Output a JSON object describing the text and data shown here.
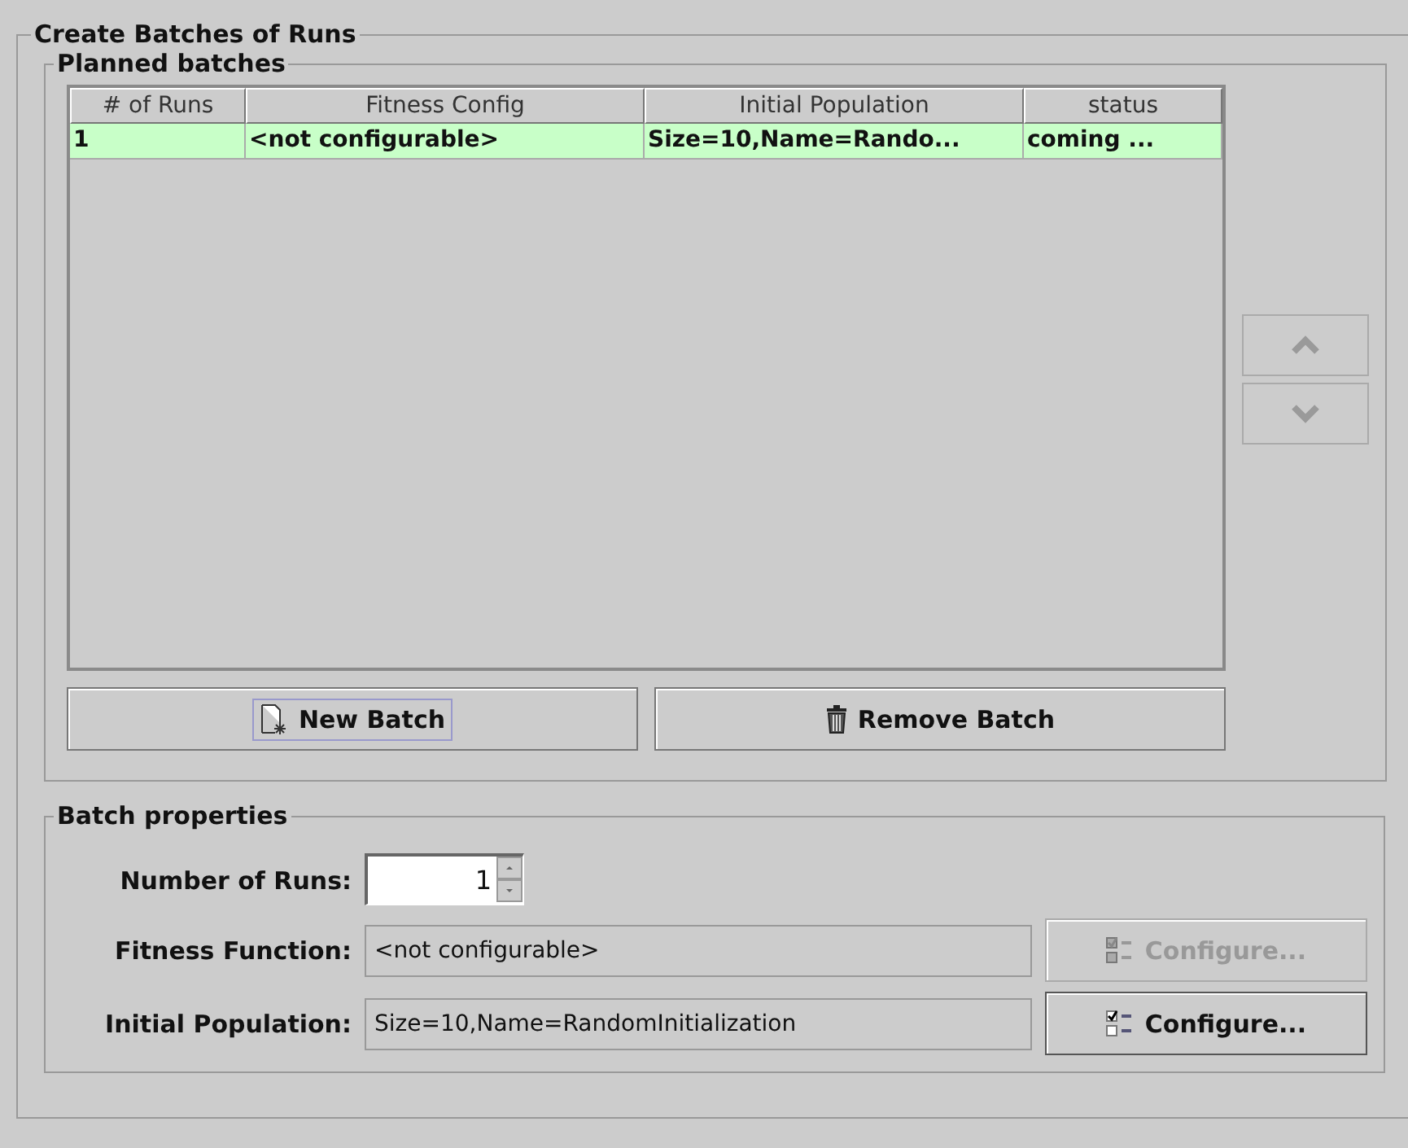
{
  "group": {
    "title": "Create Batches of Runs"
  },
  "planned": {
    "title": "Planned batches",
    "columns": [
      "# of Runs",
      "Fitness Config",
      "Initial Population",
      "status"
    ],
    "rows": [
      {
        "cells": [
          "1",
          "<not configurable>",
          "Size=10,Name=Rando...",
          "coming ..."
        ],
        "selected": true
      }
    ],
    "move_up": {
      "disabled": true
    },
    "move_down": {
      "disabled": true
    },
    "buttons": [
      {
        "kind": "new",
        "label": "New Batch",
        "focused": true
      },
      {
        "kind": "remove",
        "label": "Remove Batch",
        "focused": false
      }
    ]
  },
  "properties": {
    "title": "Batch properties",
    "fields": [
      {
        "kind": "spinner",
        "label": "Number of Runs:",
        "value": "1"
      },
      {
        "kind": "config",
        "label": "Fitness Function:",
        "value": "<not configurable>",
        "button": {
          "label": "Configure...",
          "disabled": true
        }
      },
      {
        "kind": "config",
        "label": "Initial Population:",
        "value": "Size=10,Name=RandomInitialization",
        "button": {
          "label": "Configure...",
          "disabled": false
        }
      }
    ]
  }
}
